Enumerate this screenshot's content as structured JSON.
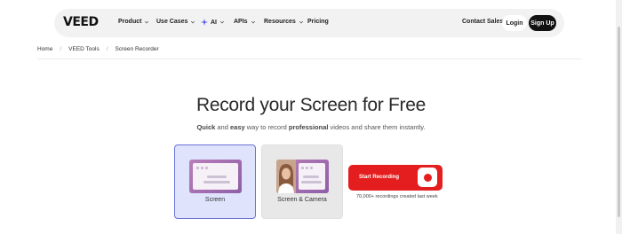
{
  "nav": {
    "logo": "VEED",
    "items": [
      {
        "label": "Product",
        "has_chevron": true
      },
      {
        "label": "Use Cases",
        "has_chevron": true
      },
      {
        "label": "AI",
        "has_chevron": true,
        "icon": "sparkle-icon"
      },
      {
        "label": "APIs",
        "has_chevron": true
      },
      {
        "label": "Resources",
        "has_chevron": true
      },
      {
        "label": "Pricing",
        "has_chevron": false
      }
    ],
    "contact_sales": "Contact Sales",
    "login": "Login",
    "signup": "Sign Up"
  },
  "breadcrumb": [
    "Home",
    "VEED Tools",
    "Screen Recorder"
  ],
  "hero": {
    "title": "Record your Screen for Free",
    "subtitle_parts": [
      "Quick",
      " and ",
      "easy",
      " way to record ",
      "professional",
      " videos and share them instantly."
    ]
  },
  "modes": [
    {
      "label": "Screen",
      "selected": true
    },
    {
      "label": "Screen & Camera",
      "selected": false
    }
  ],
  "cta": {
    "label": "Start Recording",
    "note": "70,000+ recordings created last week"
  },
  "colors": {
    "accent_red": "#e41e1e",
    "selected_card_bg": "#dfe3fb",
    "selected_card_border": "#6b73d6",
    "ai_sparkle": "#4c55e6"
  }
}
